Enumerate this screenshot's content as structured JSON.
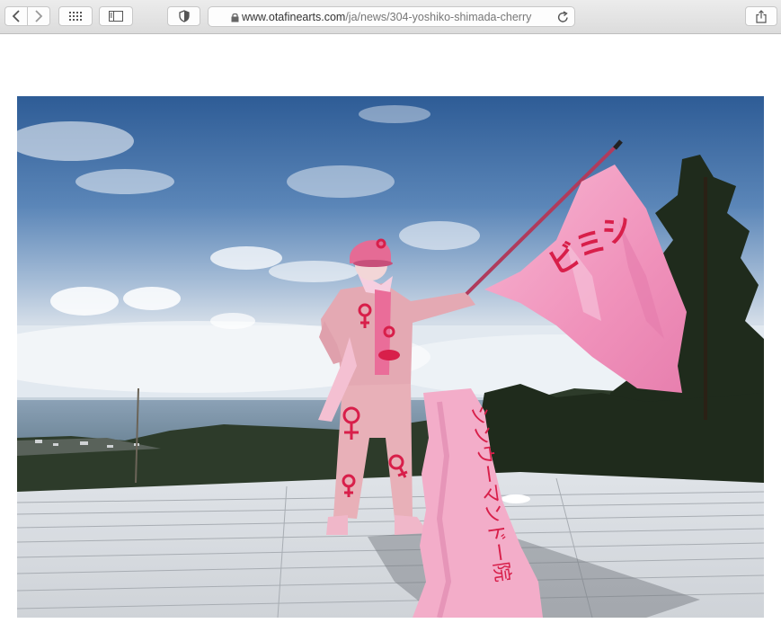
{
  "browser": {
    "url_host": "www.otafinearts.com",
    "url_path": "/ja/news/304-yoshiko-shimada-cherry",
    "icons": {
      "back": "chevron-left-icon",
      "forward": "chevron-right-icon",
      "tab_overview": "grid-icon",
      "sidebar": "sidebar-icon",
      "privacy": "shield-icon",
      "lock": "lock-icon",
      "reload": "reload-icon",
      "share": "share-icon"
    }
  },
  "photo": {
    "banner_text": "ビミシ",
    "cloth_text": "シンウーマンドー院"
  },
  "colors": {
    "sky_top": "#2f5e98",
    "sky_low": "#b8cade",
    "pink": "#f2a6c6",
    "pink_dark": "#e07aa8",
    "red_mark": "#d81f4a",
    "deck": "#e8eaec"
  }
}
